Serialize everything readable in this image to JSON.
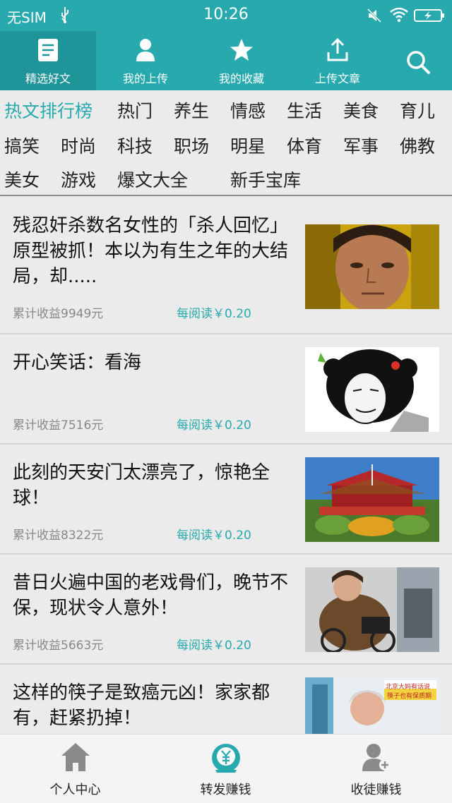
{
  "status_bar": {
    "carrier": "无SIM",
    "time": "10:26"
  },
  "top_nav": {
    "tabs": [
      {
        "label": "精选好文",
        "icon": "document-icon",
        "active": true
      },
      {
        "label": "我的上传",
        "icon": "person-icon",
        "active": false
      },
      {
        "label": "我的收藏",
        "icon": "star-icon",
        "active": false
      },
      {
        "label": "上传文章",
        "icon": "upload-icon",
        "active": false
      }
    ],
    "search_icon": "search-icon"
  },
  "categories": [
    {
      "label": "热文排行榜",
      "active": true
    },
    {
      "label": "热门"
    },
    {
      "label": "养生"
    },
    {
      "label": "情感"
    },
    {
      "label": "生活"
    },
    {
      "label": "美食"
    },
    {
      "label": "育儿"
    },
    {
      "label": "搞笑"
    },
    {
      "label": "时尚"
    },
    {
      "label": "科技"
    },
    {
      "label": "职场"
    },
    {
      "label": "明星"
    },
    {
      "label": "体育"
    },
    {
      "label": "军事"
    },
    {
      "label": "佛教"
    },
    {
      "label": "美女"
    },
    {
      "label": "游戏"
    },
    {
      "label": "爆文大全"
    },
    {
      "label": "新手宝库"
    }
  ],
  "articles": [
    {
      "title": "残忍奸杀数名女性的「杀人回忆」原型被抓！本以为有生之年的大结局，却.....",
      "earnings": "累计收益9949元",
      "rate": "每阅读￥0.20"
    },
    {
      "title": "开心笑话：看海",
      "earnings": "累计收益7516元",
      "rate": "每阅读￥0.20"
    },
    {
      "title": "此刻的天安门太漂亮了，惊艳全球！",
      "earnings": "累计收益8322元",
      "rate": "每阅读￥0.20"
    },
    {
      "title": "昔日火遍中国的老戏骨们，晚节不保，现状令人意外！",
      "earnings": "累计收益5663元",
      "rate": "每阅读￥0.20"
    },
    {
      "title": "这样的筷子是致癌元凶！家家都有，赶紧扔掉！",
      "earnings": "",
      "rate": "",
      "thumb_caption_1": "北京大妈有话说",
      "thumb_caption_2": "筷子也有保质期"
    }
  ],
  "bottom_nav": [
    {
      "label": "个人中心",
      "icon": "home-icon"
    },
    {
      "label": "转发赚钱",
      "icon": "coin-icon"
    },
    {
      "label": "收徒赚钱",
      "icon": "user-add-icon"
    }
  ],
  "colors": {
    "accent": "#27a9ad",
    "accent_dark": "#1f9599",
    "background": "#ebebeb"
  }
}
